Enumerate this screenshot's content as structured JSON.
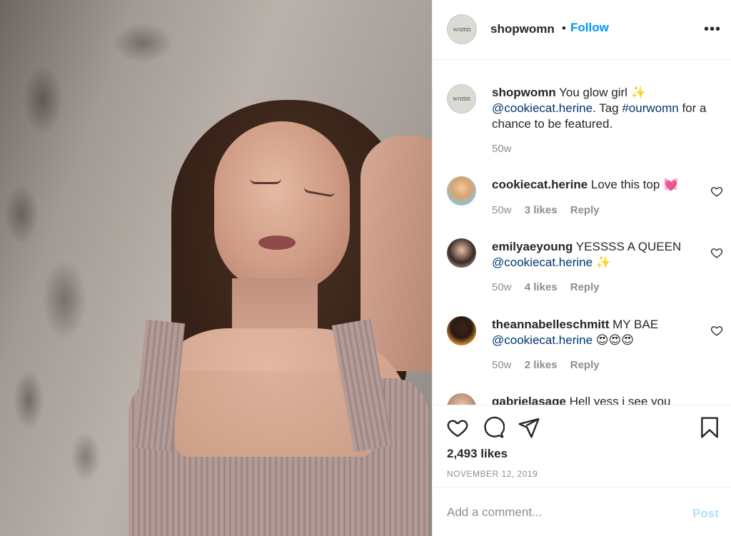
{
  "post": {
    "image_alt": "",
    "account": {
      "username": "shopwomn",
      "avatar_text": "womn",
      "dot": "•",
      "follow_label": "Follow",
      "more_icon": "ellipsis-icon",
      "more_glyph": "•••"
    },
    "caption": {
      "username": "shopwomn",
      "text": "You glow girl ✨",
      "mention": "@cookiecat.herine",
      "text_after_mention": ". Tag ",
      "hashtag": "#ourwomn",
      "text_end": " for a chance to be featured.",
      "time": "50w"
    },
    "comments": [
      {
        "username": "cookiecat.herine",
        "text": "Love this top 💓",
        "mention": "",
        "text_after": "",
        "time": "50w",
        "likes": "3 likes",
        "reply": "Reply"
      },
      {
        "username": "emilyaeyoung",
        "text": "YESSSS A QUEEN",
        "mention": "@cookiecat.herine",
        "text_after": " ✨",
        "time": "50w",
        "likes": "4 likes",
        "reply": "Reply"
      },
      {
        "username": "theannabelleschmitt",
        "text": "MY BAE",
        "mention": "@cookiecat.herine",
        "text_after": " 😍😍😍",
        "time": "50w",
        "likes": "2 likes",
        "reply": "Reply"
      },
      {
        "username": "gabrielasage",
        "text": "Hell yess i see you",
        "mention": "",
        "text_after": "",
        "time": "",
        "likes": "",
        "reply": ""
      }
    ],
    "actions": {
      "icons": [
        "heart-icon",
        "comment-icon",
        "share-icon",
        "bookmark-icon"
      ],
      "likes_count": "2,493 likes",
      "date": "NOVEMBER 12, 2019"
    },
    "add_comment": {
      "placeholder": "Add a comment...",
      "post_label": "Post"
    },
    "colors": {
      "link_blue": "#0095f6",
      "mention_blue": "#00376b",
      "muted_gray": "#8e8e8e",
      "post_disabled": "#b2dffc"
    }
  }
}
